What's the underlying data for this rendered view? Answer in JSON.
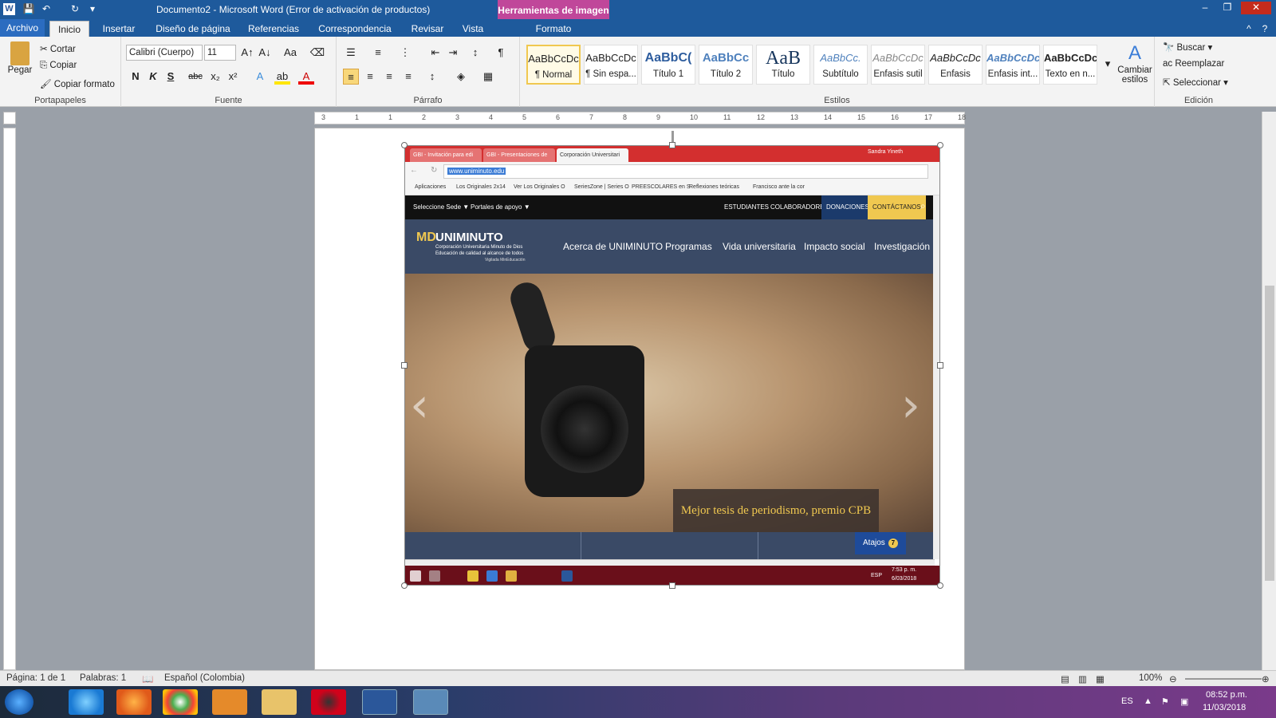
{
  "titlebar": {
    "title": "Documento2 - Microsoft Word (Error de activación de productos)",
    "context_tab_head": "Herramientas de imagen",
    "app_icon": "W",
    "quick_access": [
      "save-icon",
      "undo-icon",
      "redo-icon",
      "customize-icon"
    ],
    "minimize": "–",
    "restore": "❐",
    "close": "✕"
  },
  "tabs": [
    "Archivo",
    "Inicio",
    "Insertar",
    "Diseño de página",
    "Referencias",
    "Correspondencia",
    "Revisar",
    "Vista",
    "Formato"
  ],
  "ribbon": {
    "clipboard": {
      "label": "Portapapeles",
      "paste": "Pegar",
      "cut": "Cortar",
      "copy": "Copiar",
      "format_painter": "Copiar formato"
    },
    "font": {
      "label": "Fuente",
      "font_name": "Calibri (Cuerpo)",
      "font_size": "11",
      "bold": "N",
      "italic": "K",
      "underline": "S",
      "strike": "abc",
      "sub": "x₂",
      "sup": "x²",
      "case": "Aa"
    },
    "paragraph": {
      "label": "Párrafo",
      "pilcrow": "¶"
    },
    "styles": {
      "label": "Estilos",
      "items": [
        {
          "preview": "AaBbCcDc",
          "name": "¶ Normal"
        },
        {
          "preview": "AaBbCcDc",
          "name": "¶ Sin espa..."
        },
        {
          "preview": "AaBbC(",
          "name": "Título 1"
        },
        {
          "preview": "AaBbCc",
          "name": "Título 2"
        },
        {
          "preview": "AaB",
          "name": "Título"
        },
        {
          "preview": "AaBbCc.",
          "name": "Subtítulo"
        },
        {
          "preview": "AaBbCcDc",
          "name": "Énfasis sutil"
        },
        {
          "preview": "AaBbCcDc",
          "name": "Énfasis"
        },
        {
          "preview": "AaBbCcDc",
          "name": "Énfasis int..."
        },
        {
          "preview": "AaBbCcDc",
          "name": "Texto en n..."
        }
      ],
      "change_styles": "Cambiar estilos"
    },
    "editing": {
      "label": "Edición",
      "find": "Buscar",
      "replace": "Reemplazar",
      "select": "Seleccionar"
    }
  },
  "ruler": {
    "marks": [
      "3",
      "1",
      "1",
      "2",
      "3",
      "4",
      "5",
      "6",
      "7",
      "8",
      "9",
      "10",
      "11",
      "12",
      "13",
      "14",
      "15",
      "16",
      "17",
      "18"
    ]
  },
  "embedded": {
    "tabs": [
      "GBI - Invitación para edi",
      "GBI - Presentaciones de",
      "Corporación Universitari"
    ],
    "user": "Sandra Yineth",
    "url": "www.uniminuto.edu",
    "bookmarks": [
      "Aplicaciones",
      "Los Originales 2x14",
      "Ver Los Originales O",
      "SeriesZone | Series O",
      "PREESCOLARES en S",
      "Reflexiones teóricas",
      "Francisco ante la cor"
    ],
    "nav_top": {
      "left": [
        "Seleccione Sede ▼",
        "Portales de apoyo ▼"
      ],
      "right": [
        "ESTUDIANTES",
        "COLABORADORES",
        "DONACIONES",
        "CONTÁCTANOS"
      ]
    },
    "logo": "UNIMINUTO",
    "logo_sub": [
      "Corporación Universitaria Minuto de Dios",
      "Educación de calidad al alcance de todos",
      "Vigilada MinEducación"
    ],
    "menu": [
      "Acerca de UNIMINUTO",
      "Programas",
      "Vida universitaria",
      "Impacto social",
      "Investigación"
    ],
    "caption": "Mejor tesis de periodismo, premio CPB",
    "atajos": "Atajos",
    "atajos_badge": "7",
    "task_time": "7:53 p. m.",
    "task_date": "6/03/2018",
    "task_lang": "ESP"
  },
  "status": {
    "page": "Página: 1 de 1",
    "words": "Palabras: 1",
    "language": "Español (Colombia)",
    "zoom": "100%"
  },
  "taskbar": {
    "lang": "ES",
    "time": "08:52 p.m.",
    "date": "11/03/2018"
  },
  "colors": {
    "word_blue": "#1e5a9c",
    "context_magenta": "#c0479a",
    "site_nav": "#3a4a66",
    "contact_yellow": "#f0c850"
  }
}
